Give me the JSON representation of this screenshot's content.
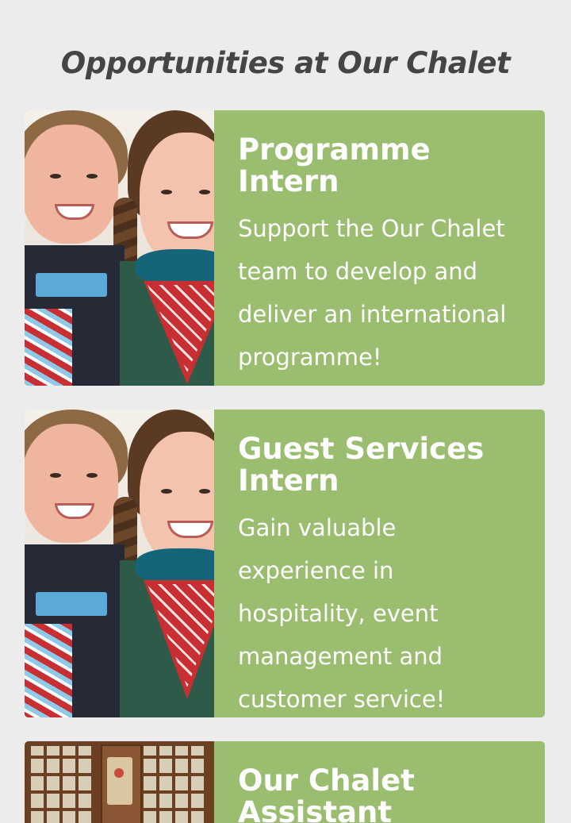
{
  "section": {
    "title": "Opportunities at Our Chalet"
  },
  "cards": [
    {
      "title": "Programme Intern",
      "description": "Support the Our Chalet team to develop and deliver an international programme!",
      "image": "scouts-photo"
    },
    {
      "title": "Guest Services Intern",
      "description": "Gain valuable experience in hospitality, event management and customer service!",
      "image": "scouts-photo"
    },
    {
      "title": "Our Chalet Assistant",
      "description": "",
      "image": "chalet-window-photo"
    }
  ],
  "colors": {
    "background": "#ececec",
    "card_green": "#9bbd6f",
    "title_text": "#454545",
    "card_text": "#ffffff"
  }
}
